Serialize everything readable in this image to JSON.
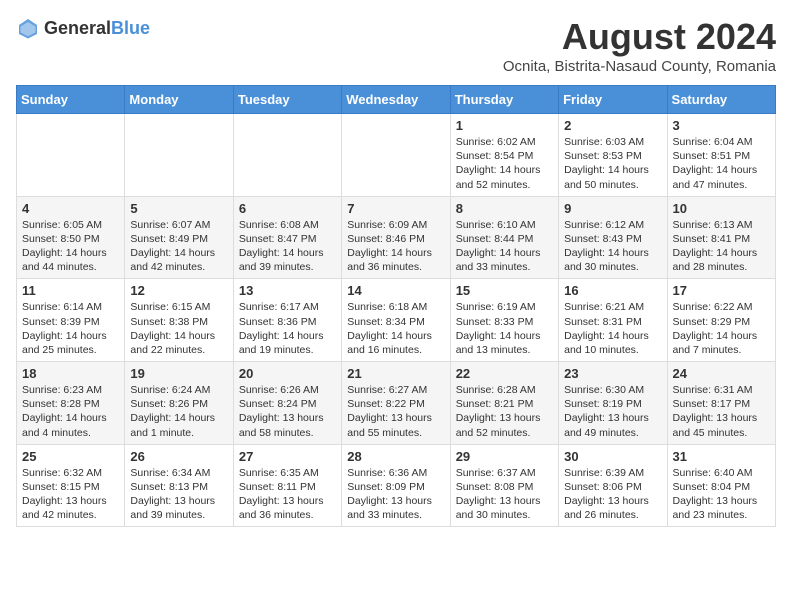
{
  "header": {
    "logo": {
      "general": "General",
      "blue": "Blue"
    },
    "title": "August 2024",
    "location": "Ocnita, Bistrita-Nasaud County, Romania"
  },
  "weekdays": [
    "Sunday",
    "Monday",
    "Tuesday",
    "Wednesday",
    "Thursday",
    "Friday",
    "Saturday"
  ],
  "weeks": [
    [
      {
        "day": "",
        "info": ""
      },
      {
        "day": "",
        "info": ""
      },
      {
        "day": "",
        "info": ""
      },
      {
        "day": "",
        "info": ""
      },
      {
        "day": "1",
        "info": "Sunrise: 6:02 AM\nSunset: 8:54 PM\nDaylight: 14 hours and 52 minutes."
      },
      {
        "day": "2",
        "info": "Sunrise: 6:03 AM\nSunset: 8:53 PM\nDaylight: 14 hours and 50 minutes."
      },
      {
        "day": "3",
        "info": "Sunrise: 6:04 AM\nSunset: 8:51 PM\nDaylight: 14 hours and 47 minutes."
      }
    ],
    [
      {
        "day": "4",
        "info": "Sunrise: 6:05 AM\nSunset: 8:50 PM\nDaylight: 14 hours and 44 minutes."
      },
      {
        "day": "5",
        "info": "Sunrise: 6:07 AM\nSunset: 8:49 PM\nDaylight: 14 hours and 42 minutes."
      },
      {
        "day": "6",
        "info": "Sunrise: 6:08 AM\nSunset: 8:47 PM\nDaylight: 14 hours and 39 minutes."
      },
      {
        "day": "7",
        "info": "Sunrise: 6:09 AM\nSunset: 8:46 PM\nDaylight: 14 hours and 36 minutes."
      },
      {
        "day": "8",
        "info": "Sunrise: 6:10 AM\nSunset: 8:44 PM\nDaylight: 14 hours and 33 minutes."
      },
      {
        "day": "9",
        "info": "Sunrise: 6:12 AM\nSunset: 8:43 PM\nDaylight: 14 hours and 30 minutes."
      },
      {
        "day": "10",
        "info": "Sunrise: 6:13 AM\nSunset: 8:41 PM\nDaylight: 14 hours and 28 minutes."
      }
    ],
    [
      {
        "day": "11",
        "info": "Sunrise: 6:14 AM\nSunset: 8:39 PM\nDaylight: 14 hours and 25 minutes."
      },
      {
        "day": "12",
        "info": "Sunrise: 6:15 AM\nSunset: 8:38 PM\nDaylight: 14 hours and 22 minutes."
      },
      {
        "day": "13",
        "info": "Sunrise: 6:17 AM\nSunset: 8:36 PM\nDaylight: 14 hours and 19 minutes."
      },
      {
        "day": "14",
        "info": "Sunrise: 6:18 AM\nSunset: 8:34 PM\nDaylight: 14 hours and 16 minutes."
      },
      {
        "day": "15",
        "info": "Sunrise: 6:19 AM\nSunset: 8:33 PM\nDaylight: 14 hours and 13 minutes."
      },
      {
        "day": "16",
        "info": "Sunrise: 6:21 AM\nSunset: 8:31 PM\nDaylight: 14 hours and 10 minutes."
      },
      {
        "day": "17",
        "info": "Sunrise: 6:22 AM\nSunset: 8:29 PM\nDaylight: 14 hours and 7 minutes."
      }
    ],
    [
      {
        "day": "18",
        "info": "Sunrise: 6:23 AM\nSunset: 8:28 PM\nDaylight: 14 hours and 4 minutes."
      },
      {
        "day": "19",
        "info": "Sunrise: 6:24 AM\nSunset: 8:26 PM\nDaylight: 14 hours and 1 minute."
      },
      {
        "day": "20",
        "info": "Sunrise: 6:26 AM\nSunset: 8:24 PM\nDaylight: 13 hours and 58 minutes."
      },
      {
        "day": "21",
        "info": "Sunrise: 6:27 AM\nSunset: 8:22 PM\nDaylight: 13 hours and 55 minutes."
      },
      {
        "day": "22",
        "info": "Sunrise: 6:28 AM\nSunset: 8:21 PM\nDaylight: 13 hours and 52 minutes."
      },
      {
        "day": "23",
        "info": "Sunrise: 6:30 AM\nSunset: 8:19 PM\nDaylight: 13 hours and 49 minutes."
      },
      {
        "day": "24",
        "info": "Sunrise: 6:31 AM\nSunset: 8:17 PM\nDaylight: 13 hours and 45 minutes."
      }
    ],
    [
      {
        "day": "25",
        "info": "Sunrise: 6:32 AM\nSunset: 8:15 PM\nDaylight: 13 hours and 42 minutes."
      },
      {
        "day": "26",
        "info": "Sunrise: 6:34 AM\nSunset: 8:13 PM\nDaylight: 13 hours and 39 minutes."
      },
      {
        "day": "27",
        "info": "Sunrise: 6:35 AM\nSunset: 8:11 PM\nDaylight: 13 hours and 36 minutes."
      },
      {
        "day": "28",
        "info": "Sunrise: 6:36 AM\nSunset: 8:09 PM\nDaylight: 13 hours and 33 minutes."
      },
      {
        "day": "29",
        "info": "Sunrise: 6:37 AM\nSunset: 8:08 PM\nDaylight: 13 hours and 30 minutes."
      },
      {
        "day": "30",
        "info": "Sunrise: 6:39 AM\nSunset: 8:06 PM\nDaylight: 13 hours and 26 minutes."
      },
      {
        "day": "31",
        "info": "Sunrise: 6:40 AM\nSunset: 8:04 PM\nDaylight: 13 hours and 23 minutes."
      }
    ]
  ]
}
